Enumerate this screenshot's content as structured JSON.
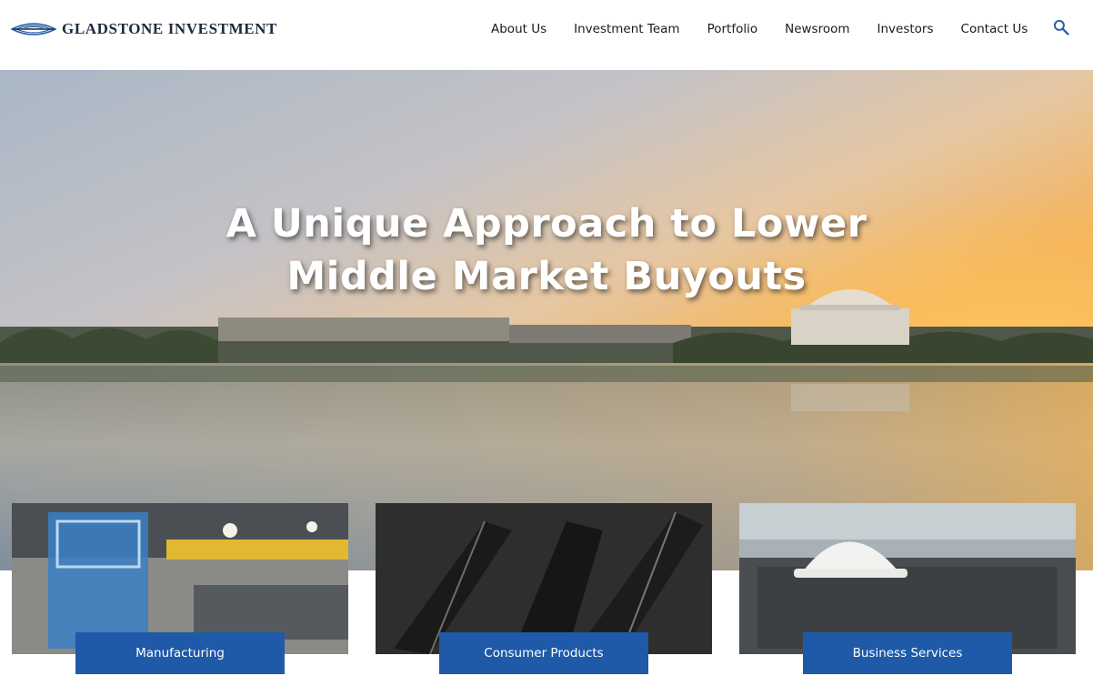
{
  "brand": {
    "name": "GLADSTONE INVESTMENT",
    "logo_icon": "eye-logo-icon",
    "accent_color": "#1f5aa8"
  },
  "nav": {
    "items": [
      {
        "label": "About Us"
      },
      {
        "label": "Investment Team"
      },
      {
        "label": "Portfolio"
      },
      {
        "label": "Newsroom"
      },
      {
        "label": "Investors"
      },
      {
        "label": "Contact Us"
      }
    ],
    "search_icon": "search-icon"
  },
  "hero": {
    "title_line1": "A Unique Approach to Lower",
    "title_line2": "Middle Market Buyouts",
    "image": "washington-dc-tidal-basin-sunrise"
  },
  "cards": [
    {
      "label": "Manufacturing",
      "image": "factory-floor"
    },
    {
      "label": "Consumer Products",
      "image": "folding-knives"
    },
    {
      "label": "Business Services",
      "image": "hard-hat-on-ac-units"
    }
  ]
}
